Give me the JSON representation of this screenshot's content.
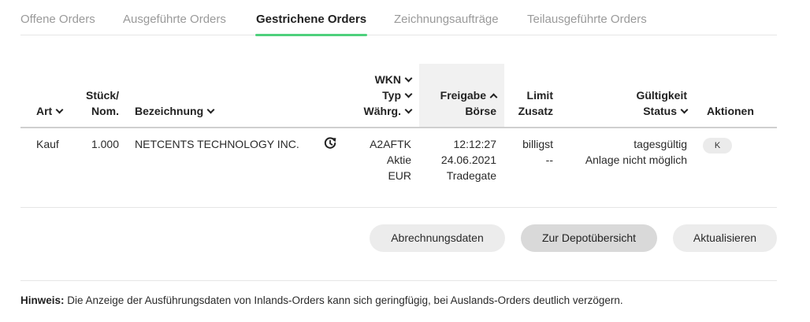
{
  "tabs": [
    {
      "label": "Offene Orders"
    },
    {
      "label": "Ausgeführte Orders"
    },
    {
      "label": "Gestrichene Orders"
    },
    {
      "label": "Zeichnungsaufträge"
    },
    {
      "label": "Teilausgeführte Orders"
    }
  ],
  "active_tab": "Gestrichene Orders",
  "accent_color": "#4ed07c",
  "columns": {
    "art": "Art",
    "stueck_line1": "Stück/",
    "stueck_line2": "Nom.",
    "bezeichnung": "Bezeichnung",
    "wkn": "WKN",
    "typ": "Typ",
    "waehrg": "Währg.",
    "freigabe": "Freigabe",
    "boerse": "Börse",
    "limit": "Limit",
    "zusatz": "Zusatz",
    "gueltigkeit": "Gültigkeit",
    "status": "Status",
    "aktionen": "Aktionen"
  },
  "rows": [
    {
      "art": "Kauf",
      "stueck": "1.000",
      "bezeichnung": "NETCENTS TECHNOLOGY INC.",
      "icon": "history-refresh-icon",
      "wkn": "A2AFTK",
      "typ": "Aktie",
      "waehrung": "EUR",
      "freigabe_zeit": "12:12:27",
      "freigabe_datum": "24.06.2021",
      "boerse": "Tradegate",
      "limit": "billigst",
      "zusatz": "--",
      "gueltigkeit": "tagesgültig",
      "status": "Anlage nicht möglich",
      "aktion": "K"
    }
  ],
  "buttons": {
    "abrechnung": "Abrechnungsdaten",
    "depot": "Zur Depotübersicht",
    "aktualisieren": "Aktualisieren"
  },
  "hint": {
    "label": "Hinweis:",
    "text": " Die Anzeige der Ausführungsdaten von Inlands-Orders kann sich geringfügig, bei Auslands-Orders deutlich verzögern."
  }
}
